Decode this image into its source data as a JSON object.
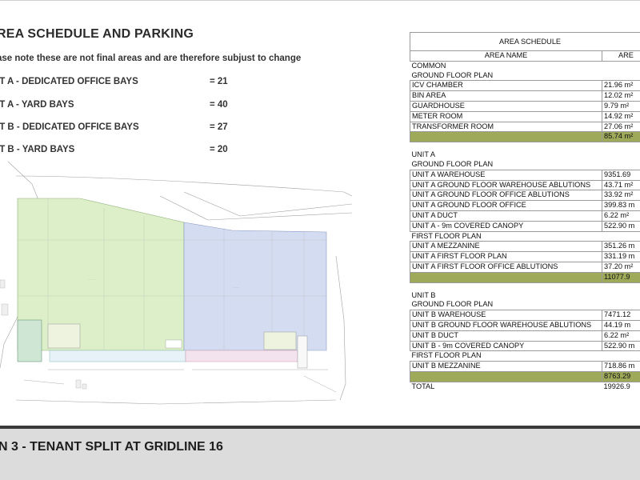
{
  "header": {
    "title": "REA SCHEDULE AND PARKING",
    "note": "ase note these are not final areas and are therefore subjust to change"
  },
  "bays": [
    {
      "label": "IT A - DEDICATED OFFICE BAYS",
      "value": "= 21"
    },
    {
      "label": "IT A - YARD BAYS",
      "value": "= 40"
    },
    {
      "label": "IT B - DEDICATED OFFICE BAYS",
      "value": "= 27"
    },
    {
      "label": "IT B - YARD BAYS",
      "value": "= 20"
    }
  ],
  "schedule": {
    "caption": "AREA SCHEDULE",
    "col_name": "AREA NAME",
    "col_area": "ARE",
    "common": {
      "heading": "COMMON",
      "sub": "GROUND FLOOR PLAN",
      "rows": [
        {
          "name": "ICV CHAMBER",
          "area": "21.96 m²"
        },
        {
          "name": "BIN AREA",
          "area": "12.02 m²"
        },
        {
          "name": "GUARDHOUSE",
          "area": "9.79 m²"
        },
        {
          "name": "METER ROOM",
          "area": "14.92 m²"
        },
        {
          "name": "TRANSFORMER ROOM",
          "area": "27.06 m²"
        }
      ],
      "total": "85.74 m²"
    },
    "unit_a": {
      "heading": "UNIT A",
      "sub_ground": "GROUND FLOOR PLAN",
      "ground_rows": [
        {
          "name": "UNIT A WAREHOUSE",
          "area": "9351.69"
        },
        {
          "name": "UNIT A GROUND FLOOR WAREHOUSE ABLUTIONS",
          "area": "43.71 m²"
        },
        {
          "name": "UNIT A GROUND FLOOR OFFICE ABLUTIONS",
          "area": "33.92 m²"
        },
        {
          "name": "UNIT A GROUND FLOOR OFFICE",
          "area": "399.83 m"
        },
        {
          "name": "UNIT A DUCT",
          "area": "6.22 m²"
        },
        {
          "name": "UNIT A - 9m COVERED CANOPY",
          "area": "522.90 m"
        }
      ],
      "sub_first": "FIRST FLOOR PLAN",
      "first_rows": [
        {
          "name": "UNIT A MEZZANINE",
          "area": "351.26 m"
        },
        {
          "name": "UNIT A FIRST FLOOR PLAN",
          "area": "331.19 m"
        },
        {
          "name": "UNIT A FIRST FLOOR OFFICE ABLUTIONS",
          "area": "37.20 m²"
        }
      ],
      "total": "11077.9"
    },
    "unit_b": {
      "heading": "UNIT B",
      "sub_ground": "GROUND FLOOR PLAN",
      "ground_rows": [
        {
          "name": "UNIT B WAREHOUSE",
          "area": "7471.12"
        },
        {
          "name": "UNIT B GROUND FLOOR WAREHOUSE ABLUTIONS",
          "area": "44.19 m"
        },
        {
          "name": "UNIT B DUCT",
          "area": "6.22 m²"
        },
        {
          "name": "UNIT B - 9m COVERED CANOPY",
          "area": "522.90 m"
        }
      ],
      "sub_first": "FIRST FLOOR PLAN",
      "first_rows": [
        {
          "name": "UNIT B MEZZANINE",
          "area": "718.86 m"
        }
      ],
      "total": "8763.29"
    },
    "grand_total_label": "TOTAL",
    "grand_total": "19926.9"
  },
  "footer": {
    "title": "N 3 - TENANT SPLIT AT GRIDLINE 16"
  },
  "colors": {
    "unit_a_fill": "#dcefc8",
    "unit_b_fill": "#d3dcf0",
    "total_row": "#9fa95a",
    "bottom_bar": "#dcdcdc"
  }
}
